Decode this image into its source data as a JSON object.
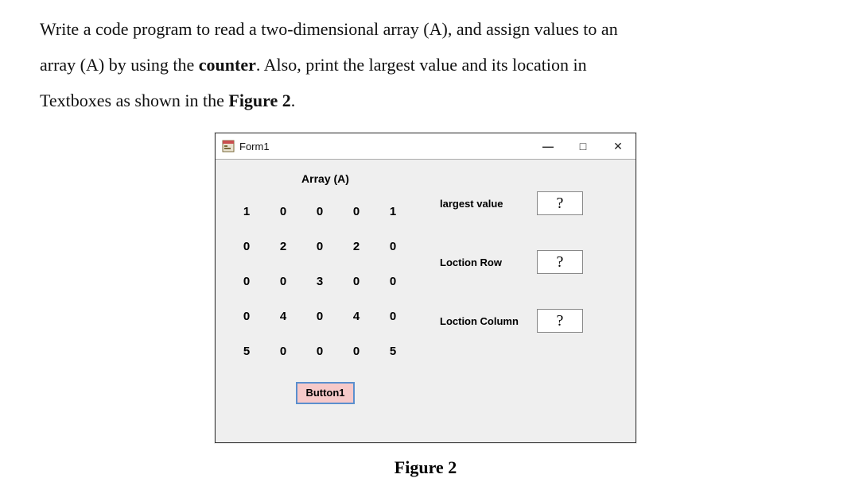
{
  "prompt": {
    "line1_pre": "Write a code program to read a two-dimensional array (A), and assign values to an",
    "line2_pre": "array (A) by using the ",
    "line2_bold": "counter",
    "line2_post": ". Also, print the largest value and its location in",
    "line3_pre": "Textboxes as shown in the ",
    "line3_bold": "Figure 2",
    "line3_post": "."
  },
  "window": {
    "title": "Form1",
    "minimize_glyph": "—",
    "maximize_glyph": "□",
    "close_glyph": "✕"
  },
  "array_heading": "Array (A)",
  "grid": [
    [
      "1",
      "0",
      "0",
      "0",
      "1"
    ],
    [
      "0",
      "2",
      "0",
      "2",
      "0"
    ],
    [
      "0",
      "0",
      "3",
      "0",
      "0"
    ],
    [
      "0",
      "4",
      "0",
      "4",
      "0"
    ],
    [
      "5",
      "0",
      "0",
      "0",
      "5"
    ]
  ],
  "button1_label": "Button1",
  "fields": {
    "largest": {
      "label": "largest value",
      "value": "?"
    },
    "row": {
      "label": "Loction Row",
      "value": "?"
    },
    "col": {
      "label": "Loction Column",
      "value": "?"
    }
  },
  "figure_caption": "Figure 2"
}
